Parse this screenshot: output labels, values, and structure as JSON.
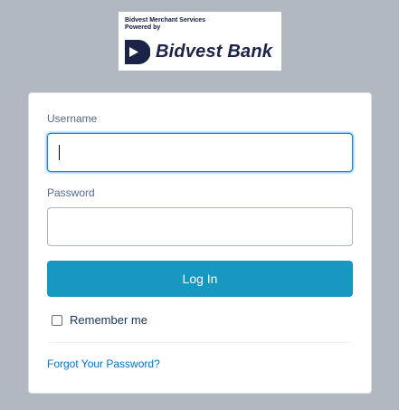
{
  "logo": {
    "line1": "Bidvest Merchant Services",
    "line2": "Powered by",
    "wordmark": "Bidvest Bank",
    "icon": "bidvest-logo-mark"
  },
  "form": {
    "username_label": "Username",
    "username_value": "",
    "password_label": "Password",
    "password_value": "",
    "login_label": "Log In",
    "remember_label": "Remember me",
    "remember_checked": false,
    "forgot_label": "Forgot Your Password?"
  },
  "colors": {
    "background": "#b1b8c0",
    "button": "#1798c1",
    "link": "#0070d2",
    "focus_border": "#1589ee",
    "brand_navy": "#1b2347"
  }
}
